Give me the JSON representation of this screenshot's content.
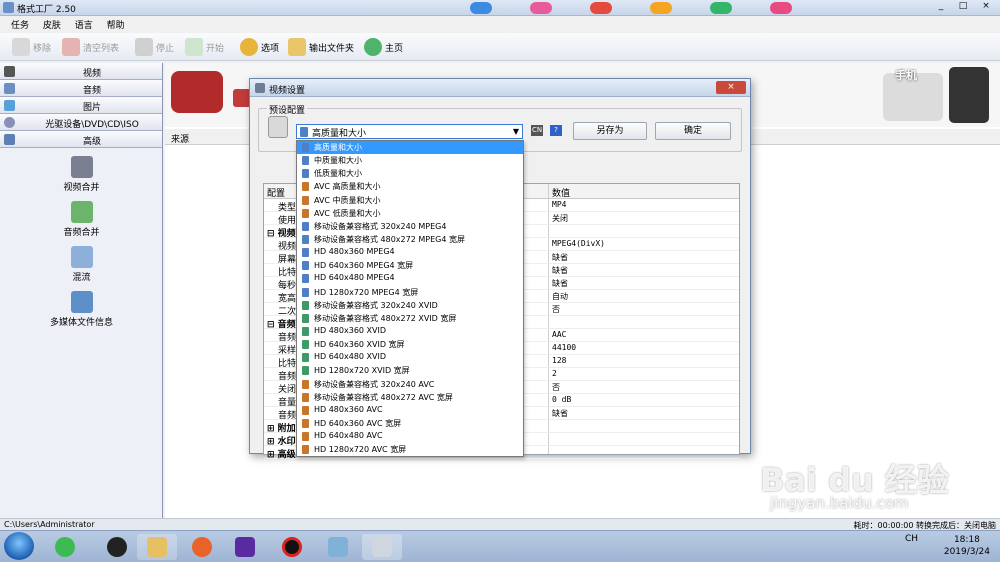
{
  "window": {
    "title": "格式工厂 2.50",
    "controls": [
      "_",
      "□",
      "×"
    ]
  },
  "menu": [
    "任务",
    "皮肤",
    "语言",
    "帮助"
  ],
  "toolbar": {
    "remove": "移除",
    "clear_list": "清空列表",
    "stop": "停止",
    "start": "开始",
    "options": "选项",
    "output_folder": "输出文件夹",
    "home": "主页"
  },
  "sidebar": {
    "categories": [
      "视频",
      "音频",
      "图片",
      "光驱设备\\DVD\\CD\\ISO",
      "高级"
    ],
    "tools": [
      "视频合并",
      "音频合并",
      "混流",
      "多媒体文件信息"
    ]
  },
  "source_label": "来源",
  "banner": {
    "phone_label": "手机"
  },
  "statusbar": {
    "path": "C:\\Users\\Administrator",
    "right": "耗时：00:00:00    转换完成后：关闭电脑"
  },
  "dialog": {
    "title": "视频设置",
    "close": "×",
    "preset_group": "预设配置",
    "preset_value": "高质量和大小",
    "save_as": "另存为",
    "ok": "确定",
    "grid_headers": [
      "配置",
      "数值"
    ],
    "rows": [
      {
        "key": "类型",
        "value": "MP4"
      },
      {
        "key": "使用系",
        "value": "关闭"
      },
      {
        "key": "⊟ 视频",
        "value": "",
        "section": true
      },
      {
        "key": "视频",
        "value": "MPEG4(DivX)"
      },
      {
        "key": "屏幕",
        "value": "缺省"
      },
      {
        "key": "比特",
        "value": "缺省"
      },
      {
        "key": "每秒",
        "value": "缺省"
      },
      {
        "key": "宽高",
        "value": "自动"
      },
      {
        "key": "二次",
        "value": "否"
      },
      {
        "key": "⊟ 音频",
        "value": "",
        "section": true
      },
      {
        "key": "音频",
        "value": "AAC"
      },
      {
        "key": "采样",
        "value": "44100"
      },
      {
        "key": "比特",
        "value": "128"
      },
      {
        "key": "音频",
        "value": "2"
      },
      {
        "key": "关闭",
        "value": "否"
      },
      {
        "key": "音量",
        "value": "0 dB"
      },
      {
        "key": "音频",
        "value": "缺省"
      },
      {
        "key": "⊞ 附加",
        "value": "",
        "section": true
      },
      {
        "key": "⊞ 水印",
        "value": "",
        "section": true
      },
      {
        "key": "⊞ 高级",
        "value": "",
        "section": true
      }
    ]
  },
  "dropdown_options": [
    {
      "label": "高质量和大小",
      "color": "#4e7fc7",
      "selected": true
    },
    {
      "label": "中质量和大小",
      "color": "#4e7fc7"
    },
    {
      "label": "低质量和大小",
      "color": "#4e7fc7"
    },
    {
      "label": "AVC 高质量和大小",
      "color": "#c8762c"
    },
    {
      "label": "AVC 中质量和大小",
      "color": "#c8762c"
    },
    {
      "label": "AVC 低质量和大小",
      "color": "#c8762c"
    },
    {
      "label": "移动设备兼容格式 320x240 MPEG4",
      "color": "#4e7fc7"
    },
    {
      "label": "移动设备兼容格式 480x272 MPEG4 宽屏",
      "color": "#4e7fc7"
    },
    {
      "label": "HD 480x360 MPEG4",
      "color": "#4e7fc7"
    },
    {
      "label": "HD 640x360 MPEG4 宽屏",
      "color": "#4e7fc7"
    },
    {
      "label": "HD 640x480 MPEG4",
      "color": "#4e7fc7"
    },
    {
      "label": "HD 1280x720 MPEG4 宽屏",
      "color": "#4e7fc7"
    },
    {
      "label": "移动设备兼容格式 320x240 XVID",
      "color": "#3f9a6a"
    },
    {
      "label": "移动设备兼容格式 480x272 XVID 宽屏",
      "color": "#3f9a6a"
    },
    {
      "label": "HD 480x360 XVID",
      "color": "#3f9a6a"
    },
    {
      "label": "HD 640x360 XVID 宽屏",
      "color": "#3f9a6a"
    },
    {
      "label": "HD 640x480 XVID",
      "color": "#3f9a6a"
    },
    {
      "label": "HD 1280x720 XVID 宽屏",
      "color": "#3f9a6a"
    },
    {
      "label": "移动设备兼容格式 320x240 AVC",
      "color": "#c8762c"
    },
    {
      "label": "移动设备兼容格式 480x272 AVC 宽屏",
      "color": "#c8762c"
    },
    {
      "label": "HD 480x360 AVC",
      "color": "#c8762c"
    },
    {
      "label": "HD 640x360 AVC 宽屏",
      "color": "#c8762c"
    },
    {
      "label": "HD 640x480 AVC",
      "color": "#c8762c"
    },
    {
      "label": "HD 1280x720 AVC 宽屏",
      "color": "#c8762c"
    }
  ],
  "taskbar": {
    "time": "18:18",
    "date": "2019/3/24",
    "lang": "CH"
  },
  "watermark": {
    "logo": "Bai du 经验",
    "url": "jingyan.baidu.com"
  }
}
